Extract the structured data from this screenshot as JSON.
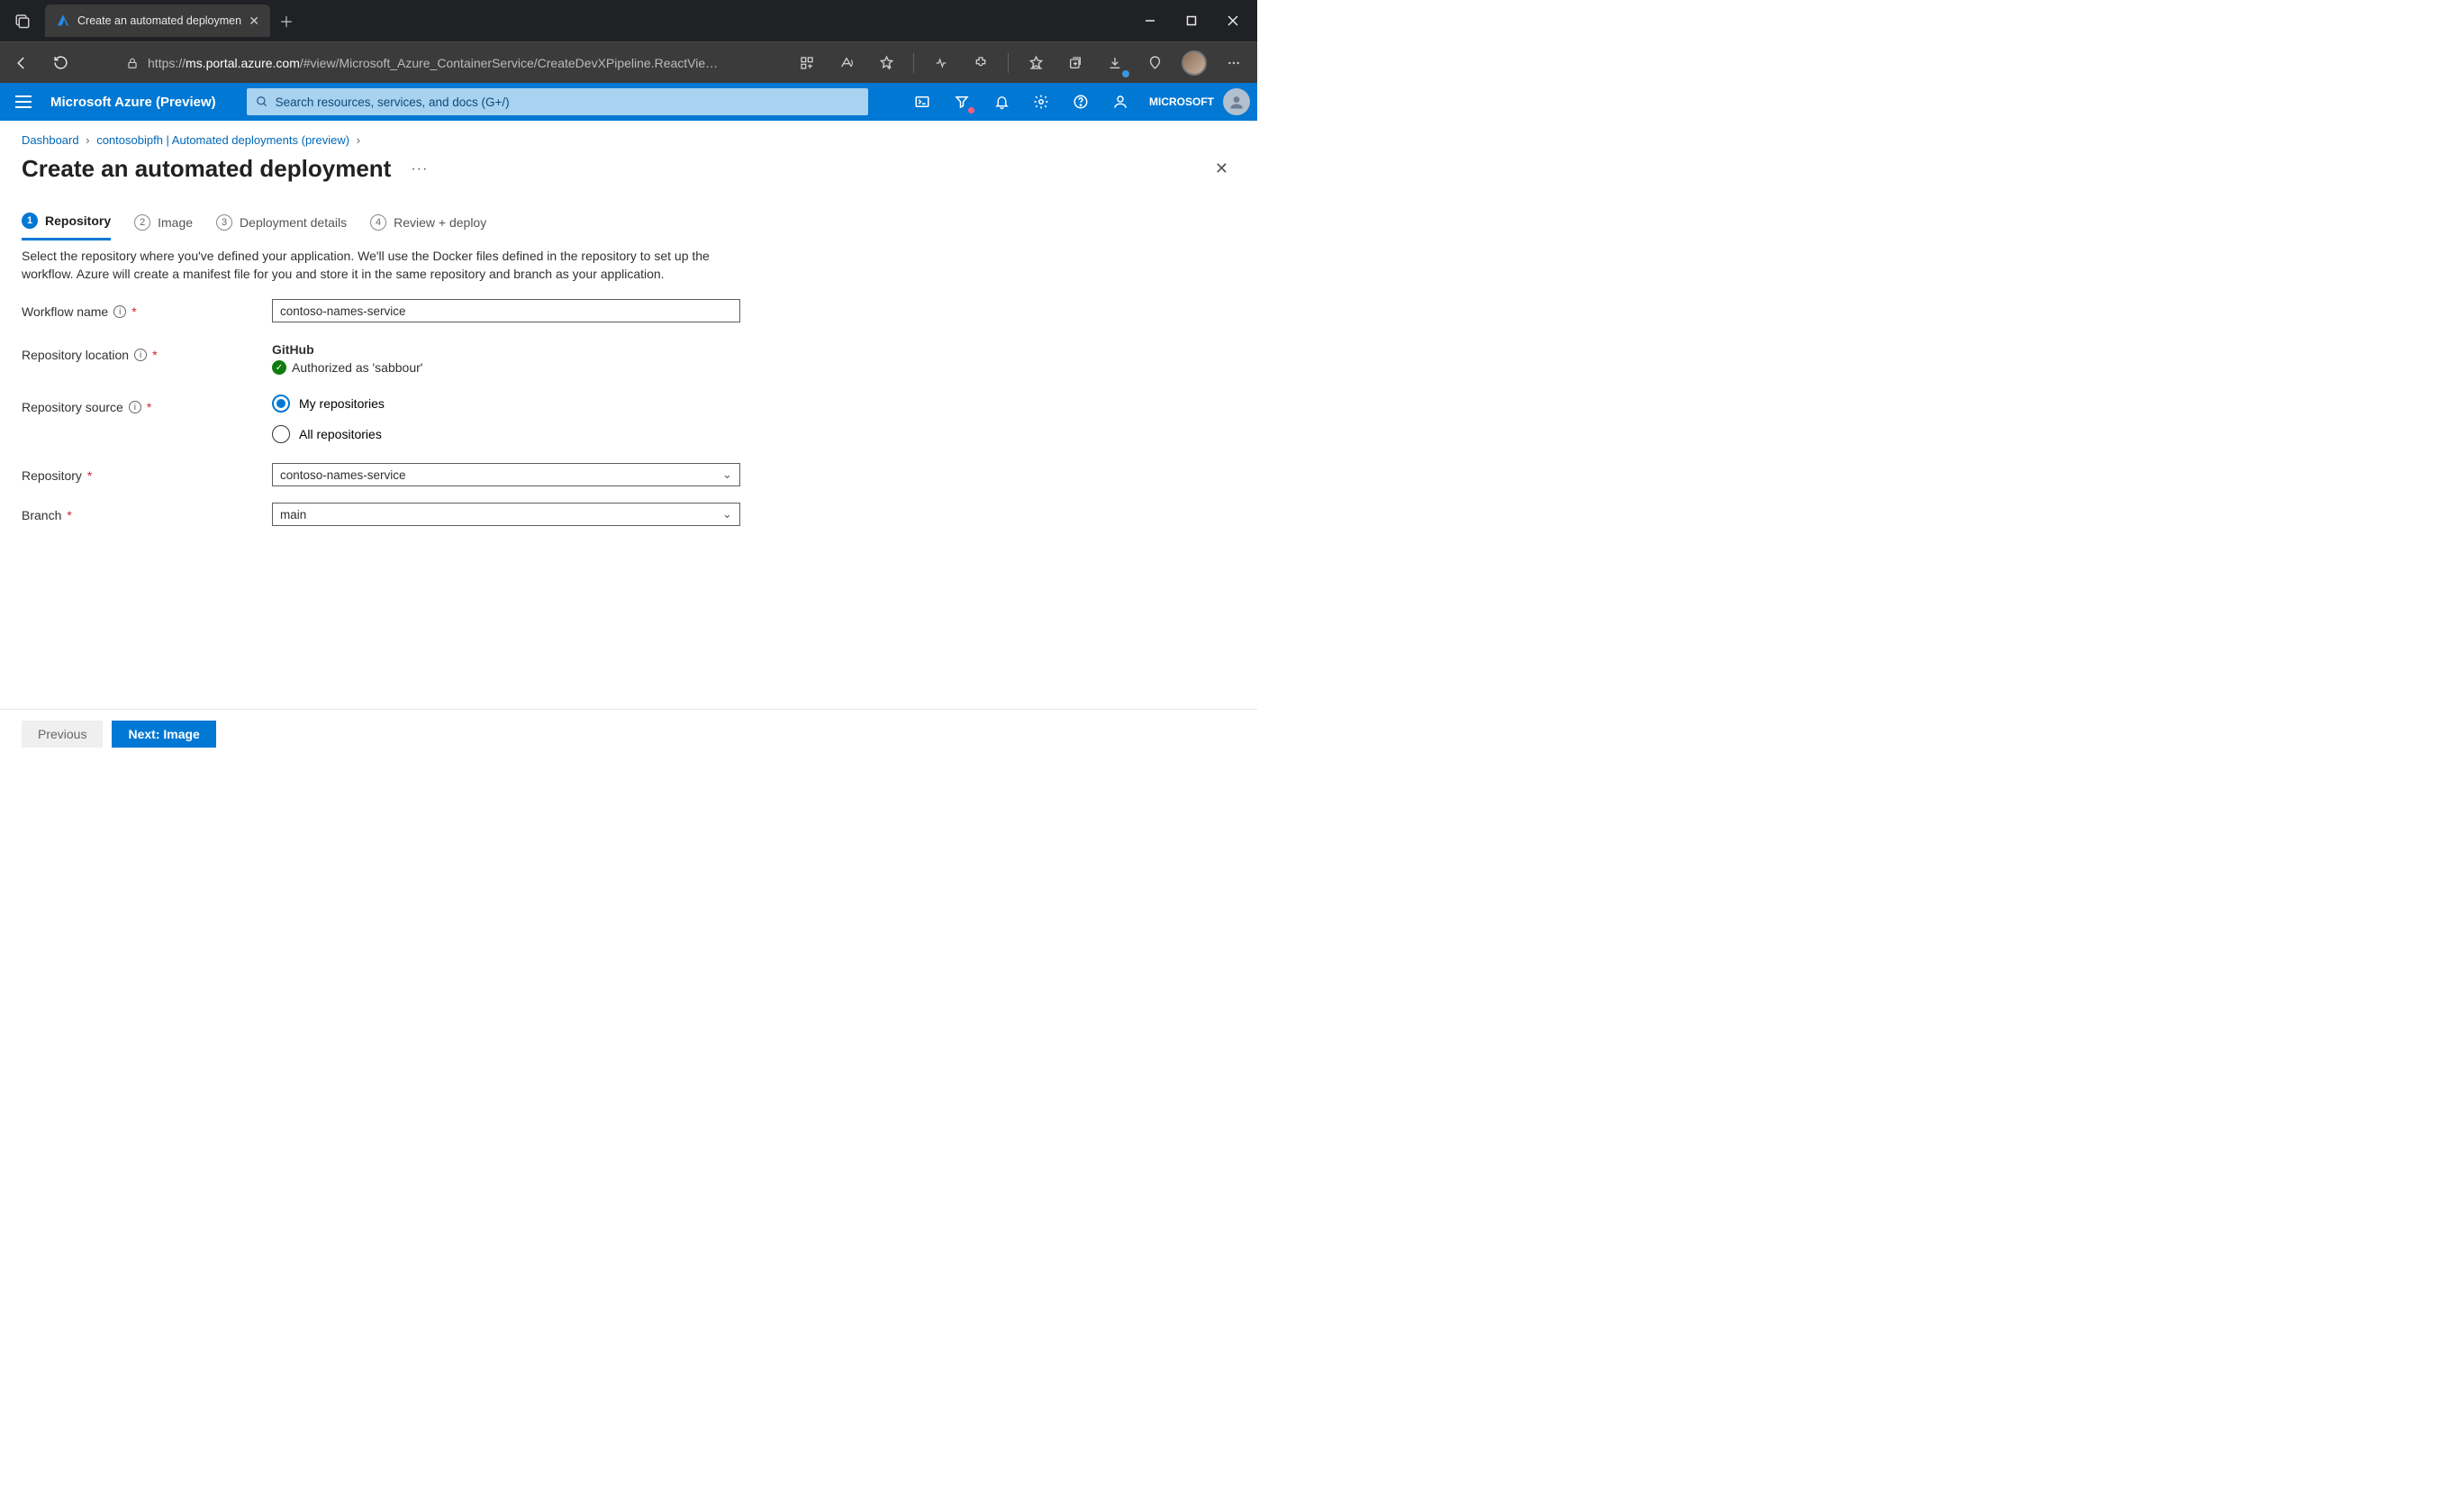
{
  "browser": {
    "tab_title": "Create an automated deploymen",
    "url_display_host": "ms.portal.azure.com",
    "url_display_rest": "/#view/Microsoft_Azure_ContainerService/CreateDevXPipeline.ReactVie…"
  },
  "azure_top": {
    "brand": "Microsoft Azure (Preview)",
    "search_placeholder": "Search resources, services, and docs (G+/)",
    "tenant": "MICROSOFT"
  },
  "breadcrumbs": {
    "items": [
      "Dashboard",
      "contosobipfh | Automated deployments (preview)"
    ]
  },
  "page": {
    "title": "Create an automated deployment"
  },
  "steps": [
    {
      "num": "1",
      "label": "Repository"
    },
    {
      "num": "2",
      "label": "Image"
    },
    {
      "num": "3",
      "label": "Deployment details"
    },
    {
      "num": "4",
      "label": "Review + deploy"
    }
  ],
  "description": "Select the repository where you've defined your application. We'll use the Docker files defined in the repository to set up the workflow. Azure will create a manifest file for you and store it in the same repository and branch as your application.",
  "form": {
    "workflow_label": "Workflow name",
    "workflow_value": "contoso-names-service",
    "repo_location_label": "Repository location",
    "repo_location_provider": "GitHub",
    "repo_location_auth": "Authorized as 'sabbour'",
    "repo_source_label": "Repository source",
    "repo_source_options": [
      "My repositories",
      "All repositories"
    ],
    "repo_label": "Repository",
    "repo_value": "contoso-names-service",
    "branch_label": "Branch",
    "branch_value": "main"
  },
  "footer": {
    "previous": "Previous",
    "next": "Next: Image"
  }
}
